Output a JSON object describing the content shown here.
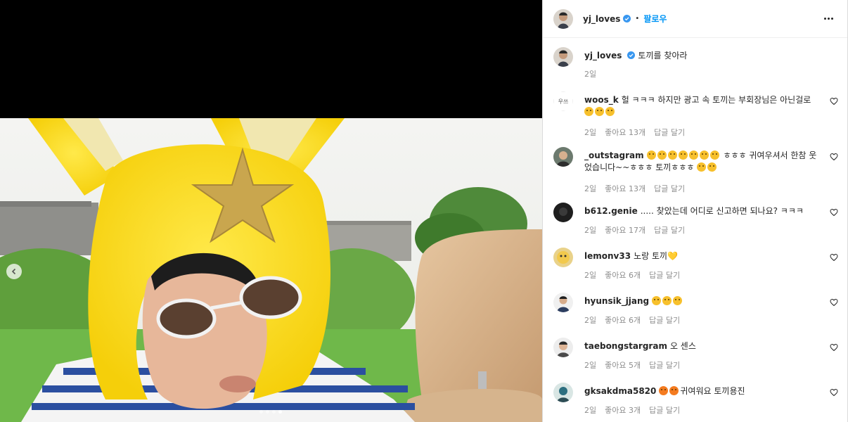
{
  "post": {
    "username": "yj_loves",
    "follow_label": "팔로우",
    "separator": "•",
    "more_label": "more-options",
    "caption": "토끼를 찾아라",
    "caption_time": "2일"
  },
  "carousel": {
    "total_slides": 4,
    "active_slide": 4
  },
  "comments": [
    {
      "username": "woos_k",
      "text": "헐 ㅋㅋㅋ 하지만 광고 속 토끼는 부회장님은 아닌걸로",
      "emoji_count": 3,
      "emoji_kind": "astonished",
      "time": "2일",
      "likes": "좋아요 13개",
      "reply": "답글 달기"
    },
    {
      "username": "_outstagram",
      "text_pre_emoji": "",
      "emoji_count": 7,
      "emoji_kind": "grin",
      "text": "ㅎㅎㅎ 귀여우셔서 한참 웃었습니다~~ㅎㅎㅎ 토끼ㅎㅎㅎ",
      "trailing_emoji_count": 2,
      "time": "2일",
      "likes": "좋아요 13개",
      "reply": "답글 달기"
    },
    {
      "username": "b612.genie",
      "text": "..... 찾았는데 어디로 신고하면 되나요? ㅋㅋㅋ",
      "time": "2일",
      "likes": "좋아요 17개",
      "reply": "답글 달기"
    },
    {
      "username": "lemonv33",
      "text": "노랑 토끼💛",
      "time": "2일",
      "likes": "좋아요 6개",
      "reply": "답글 달기"
    },
    {
      "username": "hyunsik_jjang",
      "text": "",
      "emoji_count": 3,
      "emoji_kind": "joy",
      "time": "2일",
      "likes": "좋아요 6개",
      "reply": "답글 달기"
    },
    {
      "username": "taebongstargram",
      "text": "오 센스",
      "time": "2일",
      "likes": "좋아요 5개",
      "reply": "답글 달기"
    },
    {
      "username": "gksakdma5820",
      "text": "귀여워요 토끼용진",
      "emoji_count": 2,
      "emoji_kind": "star-struck",
      "time": "2일",
      "likes": "좋아요 3개",
      "reply": "답글 달기"
    }
  ],
  "icons": {
    "verified": "verified-badge-icon",
    "heart": "heart-icon",
    "prev": "chevron-left-icon"
  },
  "colors": {
    "accent": "#0095f6",
    "meta": "#8e8e8e",
    "verified": "#3897f0"
  }
}
